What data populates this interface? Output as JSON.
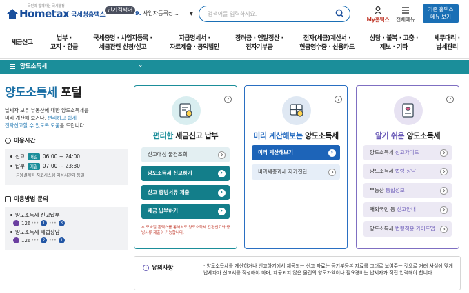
{
  "header": {
    "logo_brand": "Hometax",
    "logo_sub": "국세청홈택스",
    "logo_tiny": "국민과 함께하는 국세행정",
    "popular_label": "인기검색어",
    "popular_num": "9.",
    "popular_term": "사업자등록상...",
    "search_placeholder": "검색어를 입력하세요.",
    "my_label": "My홈택스",
    "menu_label": "전체메뉴",
    "old_btn_line1": "기존 홈택스",
    "old_btn_line2": "메뉴 보기"
  },
  "gnb": [
    {
      "l1": "세금신고",
      "l2": ""
    },
    {
      "l1": "납부 ·",
      "l2": "고지 · 환급"
    },
    {
      "l1": "국세증명 · 사업자등록 ·",
      "l2": "세금관련 신청/신고"
    },
    {
      "l1": "지급명세서 ·",
      "l2": "자료제출 · 공익법인"
    },
    {
      "l1": "장려금 · 연말정산 ·",
      "l2": "전자기부금"
    },
    {
      "l1": "전자(세금)계산서 ·",
      "l2": "현금영수증 · 신용카드"
    },
    {
      "l1": "상담 · 불복 · 고충 ·",
      "l2": "제보 · 기타"
    },
    {
      "l1": "세무대리 ·",
      "l2": "납세관리"
    }
  ],
  "bar": {
    "title": "양도소득세"
  },
  "left": {
    "title_em": "양도소득세",
    "title_rest": " 포털",
    "intro_1": "납세자 보유 부동산에 대한 양도소득세를",
    "intro_2": "미리 계산해 보거나, ",
    "intro_hl1": "편리하고 쉽게",
    "intro_hl2": "전자신고할 수 있도록 도움",
    "intro_3": "을 드립니다.",
    "hours_title": "이용시간",
    "hours": [
      {
        "label": "신고",
        "tag": "매일",
        "time": "06:00 ~ 24:00"
      },
      {
        "label": "납부",
        "tag": "매일",
        "time": "07:00 ~ 23:30"
      }
    ],
    "hours_note": "금융결제원 지로시스템 이용시간과 동일",
    "inquiry_title": "이용방법 문의",
    "inquiries": [
      {
        "label": "양도소득세 신고납부",
        "tel": "126",
        "n1": "1",
        "n2": "3"
      },
      {
        "label": "양도소득세 세법상담",
        "tel": "126",
        "n1": "2",
        "n2": "1"
      }
    ]
  },
  "cards": [
    {
      "title_em": "편리한",
      "title_rest": " 세금신고 납부",
      "buttons": [
        "신고대상 물건조회",
        "양도소득세 신고하기",
        "신고 증빙서류 제출",
        "세금 납부하기"
      ],
      "foot": "※ 모바일 홈택스를 통해서도 양도소득세 간편신고와 증빙서류 제출이 가능합니다."
    },
    {
      "title_em": "미리 계산해보는",
      "title_rest": " 양도소득세",
      "buttons": [
        "미리 계산해보기",
        "비과세증과세 자가진단"
      ]
    },
    {
      "title_em": "알기 쉬운",
      "title_rest": " 양도소득세",
      "buttons": [
        {
          "pre": "양도소득세 ",
          "em": "신고가이드"
        },
        {
          "pre": "양도소득세 ",
          "em": "법령 상담"
        },
        {
          "pre": "부동산 ",
          "em": "통합정보"
        },
        {
          "pre": "재외국민 등 ",
          "em": "신고안내"
        },
        {
          "pre": "양도소득세 ",
          "em": "법령적용 가이드맵"
        }
      ]
    }
  ],
  "notice": {
    "label": "유의사항",
    "text": "· 양도소득세를 계산하거나 신고하기에서 제공되는 신고 자료는 등기부등본 자료를 그대로 보여주는 것으로 거래 사실에 맞게 납세자가 신고서를 작성해야 하며, 제공되지 않은 물건의 양도가액이나 필요경비는 납세자가 직접 입력해야 합니다."
  },
  "colors": {
    "teal": "#1b8e9a",
    "blue": "#1d64b8",
    "purple": "#6b5bb8",
    "brand": "#1a4f9c"
  }
}
